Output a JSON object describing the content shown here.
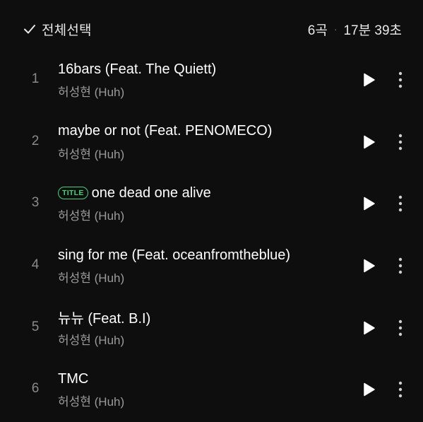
{
  "header": {
    "select_all_label": "전체선택",
    "check_icon": "check-icon",
    "track_count": "6곡",
    "separator": "·",
    "total_duration": "17분 39초"
  },
  "tracks": [
    {
      "number": "1",
      "title": "16bars (Feat. The Quiett)",
      "artist": "허성현 (Huh)",
      "badge": ""
    },
    {
      "number": "2",
      "title": "maybe or not (Feat. PENOMECO)",
      "artist": "허성현 (Huh)",
      "badge": ""
    },
    {
      "number": "3",
      "title": "one dead one alive",
      "artist": "허성현 (Huh)",
      "badge": "TITLE"
    },
    {
      "number": "4",
      "title": "sing for me (Feat. oceanfromtheblue)",
      "artist": "허성현 (Huh)",
      "badge": ""
    },
    {
      "number": "5",
      "title": "뉴뉴 (Feat. B.I)",
      "artist": "허성현 (Huh)",
      "badge": ""
    },
    {
      "number": "6",
      "title": "TMC",
      "artist": "허성현 (Huh)",
      "badge": ""
    }
  ],
  "icons": {
    "play": "play-icon",
    "more": "more-vertical-icon"
  },
  "colors": {
    "background": "#0e0e0e",
    "badge_accent": "#3fd47a",
    "secondary_text": "#9b9b9b"
  }
}
